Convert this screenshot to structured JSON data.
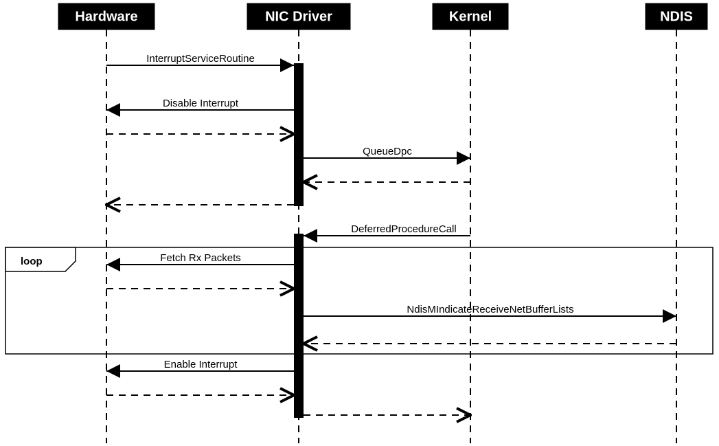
{
  "participants": {
    "hardware": "Hardware",
    "nic_driver": "NIC Driver",
    "kernel": "Kernel",
    "ndis": "NDIS"
  },
  "messages": {
    "isr": "InterruptServiceRoutine",
    "disable_int": "Disable Interrupt",
    "queue_dpc": "QueueDpc",
    "dpc": "DeferredProcedureCall",
    "fetch_rx": "Fetch Rx Packets",
    "indicate": "NdisMIndicateReceiveNetBufferLists",
    "enable_int": "Enable Interrupt"
  },
  "frame": {
    "loop": "loop"
  }
}
